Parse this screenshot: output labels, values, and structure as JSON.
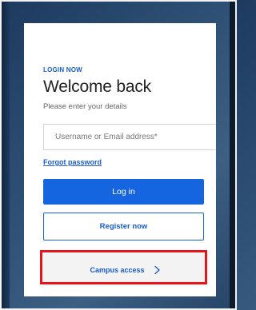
{
  "login": {
    "eyebrow": "LOGIN NOW",
    "title": "Welcome back",
    "subtitle": "Please enter your details",
    "username_placeholder": "Username or Email address*",
    "forgot_password": "Forgot password",
    "login_button": "Log in",
    "register_button": "Register now",
    "campus_access": "Campus access",
    "campus_icon": "chevron-right-icon"
  },
  "colors": {
    "accent": "#1565e0",
    "link": "#1a5ccf",
    "highlight": "#e8141b",
    "background": "#2e4f74"
  }
}
